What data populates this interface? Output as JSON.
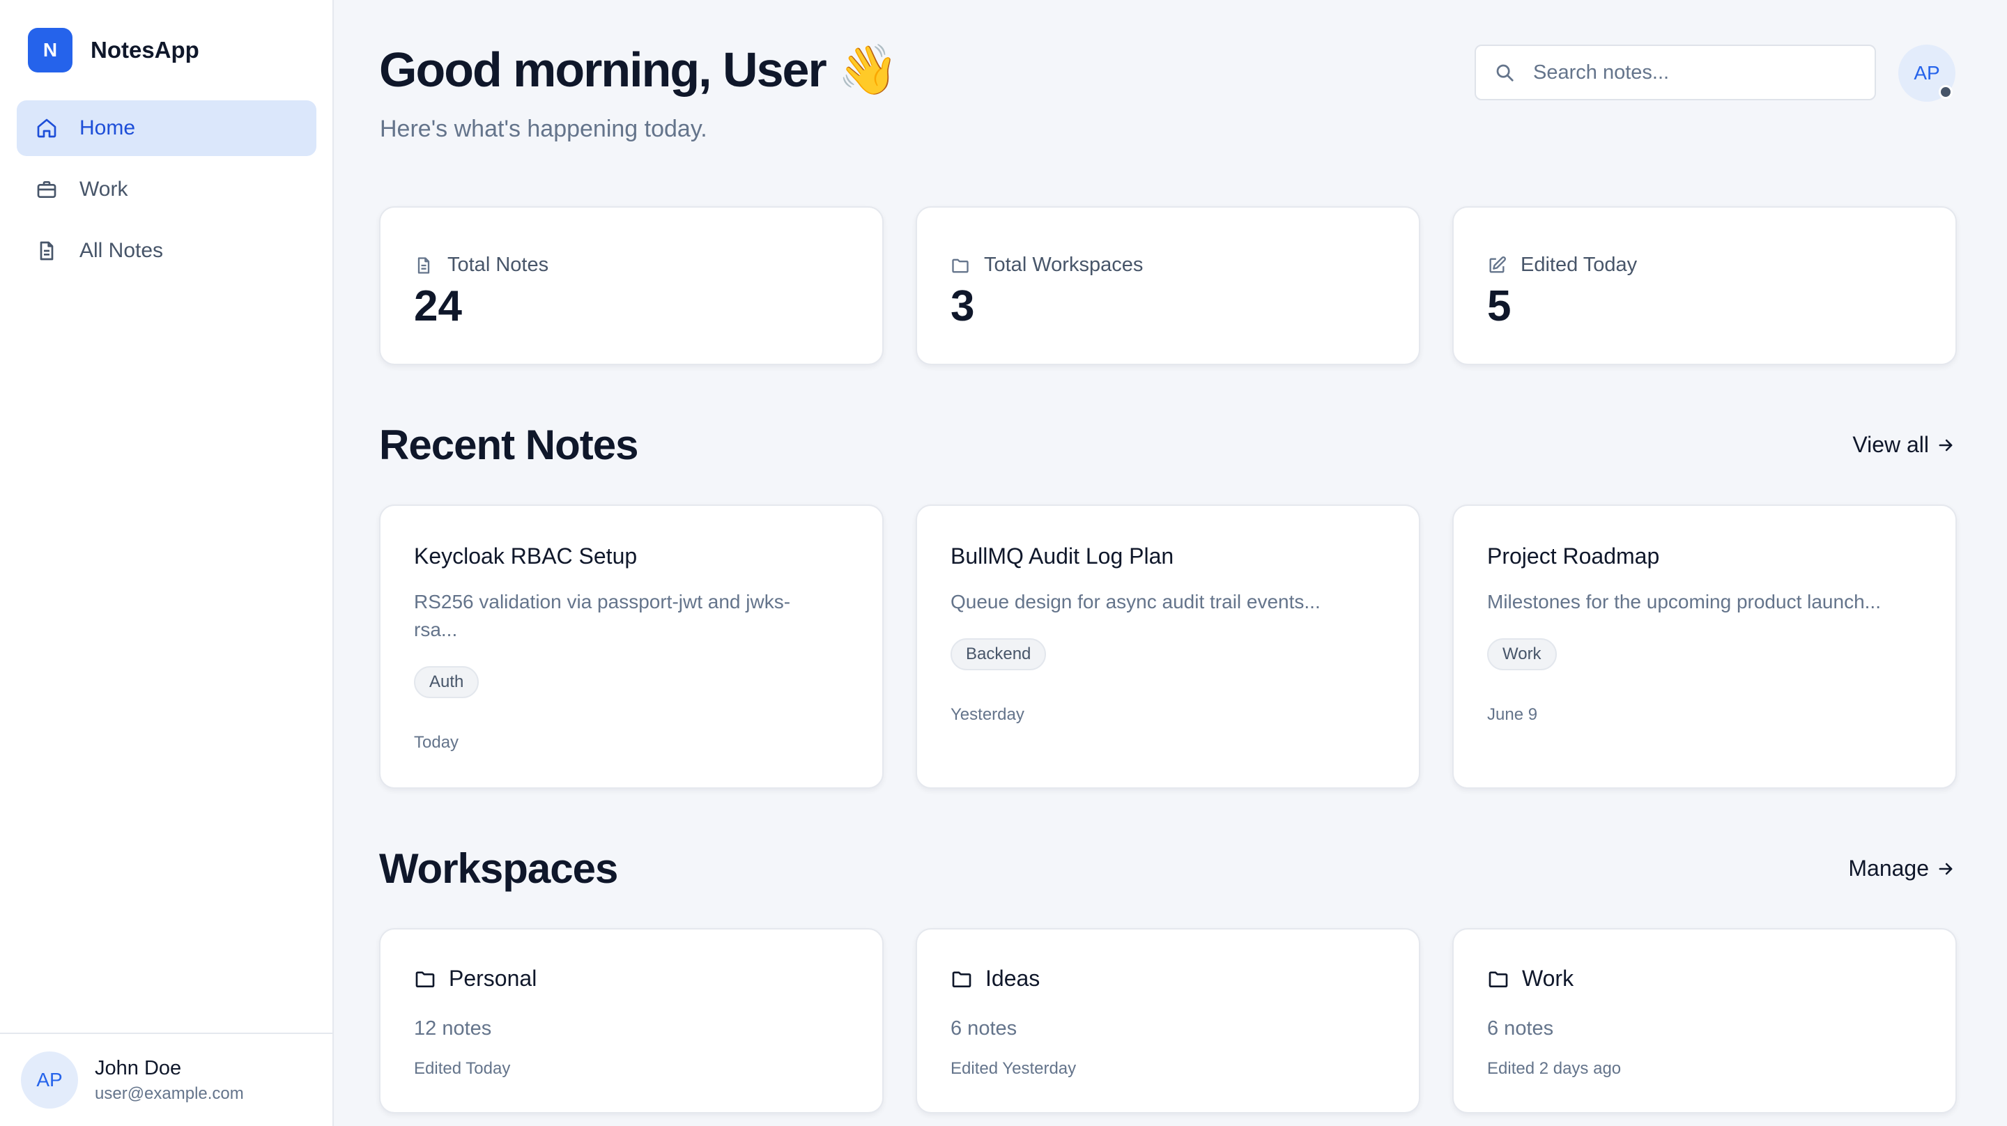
{
  "brand": {
    "logo_letter": "N",
    "name": "NotesApp"
  },
  "nav": [
    {
      "label": "Home",
      "icon": "home-icon",
      "active": true
    },
    {
      "label": "Work",
      "icon": "briefcase-icon",
      "active": false
    },
    {
      "label": "All Notes",
      "icon": "document-icon",
      "active": false
    }
  ],
  "user": {
    "initials": "AP",
    "name": "John Doe",
    "email": "user@example.com"
  },
  "header": {
    "greeting": "Good morning, User 👋",
    "subtitle": "Here's what's happening today.",
    "search_placeholder": "Search notes...",
    "avatar_initials": "AP"
  },
  "stats": [
    {
      "label": "Total Notes",
      "value": "24",
      "icon": "document-icon"
    },
    {
      "label": "Total Workspaces",
      "value": "3",
      "icon": "folder-icon"
    },
    {
      "label": "Edited Today",
      "value": "5",
      "icon": "edit-icon"
    }
  ],
  "recent": {
    "title": "Recent Notes",
    "link": "View all",
    "notes": [
      {
        "title": "Keycloak RBAC Setup",
        "description": "RS256 validation via passport-jwt and jwks-rsa...",
        "tag": "Auth",
        "date": "Today"
      },
      {
        "title": "BullMQ Audit Log Plan",
        "description": "Queue design for async audit trail events...",
        "tag": "Backend",
        "date": "Yesterday"
      },
      {
        "title": "Project Roadmap",
        "description": "Milestones for the upcoming product launch...",
        "tag": "Work",
        "date": "June 9"
      }
    ]
  },
  "workspaces": {
    "title": "Workspaces",
    "link": "Manage",
    "items": [
      {
        "name": "Personal",
        "count": "12 notes",
        "edited": "Edited Today"
      },
      {
        "name": "Ideas",
        "count": "6 notes",
        "edited": "Edited Yesterday"
      },
      {
        "name": "Work",
        "count": "6 notes",
        "edited": "Edited 2 days ago"
      }
    ]
  },
  "colors": {
    "accent": "#2563eb",
    "active_nav_bg": "#dbe7fb",
    "background": "#f4f6fa"
  }
}
